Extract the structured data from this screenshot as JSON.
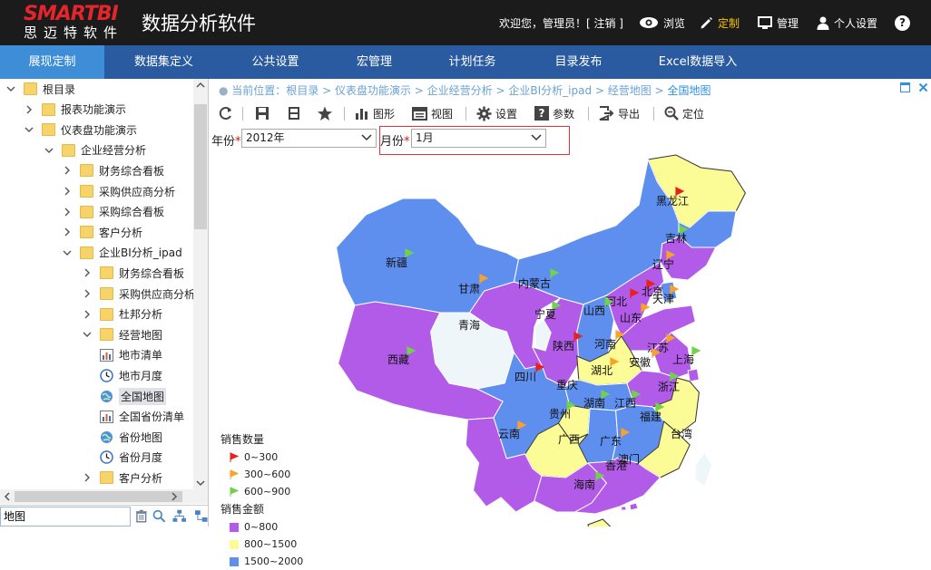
{
  "header": {
    "logo_brand": "SMARTBI",
    "logo_sub": "思迈特软件",
    "app_title": "数据分析软件",
    "welcome": "欢迎您，管理员！[ 注销 ]",
    "actions": [
      {
        "label": "浏览",
        "icon": "eye-icon",
        "color": "#ffffff"
      },
      {
        "label": "定制",
        "icon": "pencil-icon",
        "color": "#f5c400"
      },
      {
        "label": "管理",
        "icon": "monitor-icon",
        "color": "#ffffff"
      },
      {
        "label": "个人设置",
        "icon": "user-icon",
        "color": "#ffffff"
      },
      {
        "label": "?",
        "icon": "help-icon",
        "color": "#ffffff"
      }
    ]
  },
  "nav": {
    "items": [
      "展现定制",
      "数据集定义",
      "公共设置",
      "宏管理",
      "计划任务",
      "目录发布",
      "Excel数据导入"
    ],
    "active": "展现定制"
  },
  "tree": {
    "items": [
      {
        "label": "根目录",
        "type": "folder",
        "expanded": true
      },
      {
        "label": "报表功能演示",
        "type": "folder",
        "expanded": false
      },
      {
        "label": "仪表盘功能演示",
        "type": "folder",
        "expanded": true
      },
      {
        "label": "企业经营分析",
        "type": "folder",
        "expanded": true
      },
      {
        "label": "财务综合看板",
        "type": "folder",
        "expanded": false
      },
      {
        "label": "采购供应商分析",
        "type": "folder",
        "expanded": false
      },
      {
        "label": "采购综合看板",
        "type": "folder",
        "expanded": false
      },
      {
        "label": "客户分析",
        "type": "folder",
        "expanded": false
      },
      {
        "label": "企业BI分析_ipad",
        "type": "folder",
        "expanded": true
      },
      {
        "label": "财务综合看板",
        "type": "folder",
        "expanded": false
      },
      {
        "label": "采购供应商分析",
        "type": "folder",
        "expanded": false
      },
      {
        "label": "杜邦分析",
        "type": "folder",
        "expanded": false
      },
      {
        "label": "经营地图",
        "type": "folder",
        "expanded": true
      },
      {
        "label": "地市清单",
        "type": "report",
        "icon": "table-report-icon"
      },
      {
        "label": "地市月度",
        "type": "report",
        "icon": "clock-report-icon"
      },
      {
        "label": "全国地图",
        "type": "report",
        "icon": "globe-report-icon",
        "selected": true
      },
      {
        "label": "全国省份清单",
        "type": "report",
        "icon": "table-report-icon"
      },
      {
        "label": "省份地图",
        "type": "report",
        "icon": "globe-report-icon"
      },
      {
        "label": "省份月度",
        "type": "report",
        "icon": "clock-report-icon"
      },
      {
        "label": "客户分析",
        "type": "folder",
        "expanded": false
      }
    ],
    "search_value": "地图"
  },
  "breadcrumb": {
    "prefix": "当前位置：",
    "path": "根目录 > 仪表盘功能演示 > 企业经营分析 > 企业BI分析_ipad > 经营地图 > ",
    "current": "全国地图"
  },
  "toolbar": {
    "graph_label": "图形",
    "view_label": "视图",
    "settings_label": "设置",
    "params_label": "参数",
    "export_label": "导出",
    "locate_label": "定位"
  },
  "params": {
    "year_label": "年份",
    "year_value": "2012年",
    "month_label": "月份",
    "month_value": "1月",
    "required_mark": "*"
  },
  "map": {
    "colors": {
      "purple": "#b25be8",
      "yellow": "#fbfc95",
      "blue": "#5e8fee",
      "white": "#eef6fa",
      "red_flag": "#e8211c",
      "orange_flag": "#f7a22a",
      "green_flag": "#6fd24a"
    },
    "provinces": [
      {
        "name": "黑龙江",
        "fill": "yellow",
        "flag": "red"
      },
      {
        "name": "吉林",
        "fill": "blue",
        "flag": "green"
      },
      {
        "name": "辽宁",
        "fill": "purple",
        "flag": "orange"
      },
      {
        "name": "新疆",
        "fill": "blue",
        "flag": "green"
      },
      {
        "name": "内蒙古",
        "fill": "blue",
        "flag": "green"
      },
      {
        "name": "甘肃",
        "fill": "purple",
        "flag": "orange"
      },
      {
        "name": "北京",
        "fill": "purple",
        "flag": "red"
      },
      {
        "name": "天津",
        "fill": "blue",
        "flag": "orange"
      },
      {
        "name": "河北",
        "fill": "purple",
        "flag": "red"
      },
      {
        "name": "山西",
        "fill": "blue",
        "flag": "green"
      },
      {
        "name": "山东",
        "fill": "purple",
        "flag": "orange"
      },
      {
        "name": "宁夏",
        "fill": "white",
        "flag": "green"
      },
      {
        "name": "青海",
        "fill": "white",
        "flag": "none"
      },
      {
        "name": "陕西",
        "fill": "purple",
        "flag": "red"
      },
      {
        "name": "河南",
        "fill": "yellow",
        "flag": "orange"
      },
      {
        "name": "江苏",
        "fill": "purple",
        "flag": "orange"
      },
      {
        "name": "上海",
        "fill": "purple",
        "flag": "green"
      },
      {
        "name": "西藏",
        "fill": "purple",
        "flag": "green"
      },
      {
        "name": "安徽",
        "fill": "purple",
        "flag": "orange"
      },
      {
        "name": "四川",
        "fill": "blue",
        "flag": "red"
      },
      {
        "name": "湖北",
        "fill": "blue",
        "flag": "orange"
      },
      {
        "name": "重庆",
        "fill": "yellow",
        "flag": "none"
      },
      {
        "name": "浙江",
        "fill": "yellow",
        "flag": "green"
      },
      {
        "name": "湖南",
        "fill": "blue",
        "flag": "green"
      },
      {
        "name": "江西",
        "fill": "blue",
        "flag": "green"
      },
      {
        "name": "贵州",
        "fill": "yellow",
        "flag": "green"
      },
      {
        "name": "福建",
        "fill": "yellow",
        "flag": "green"
      },
      {
        "name": "云南",
        "fill": "purple",
        "flag": "orange"
      },
      {
        "name": "广西",
        "fill": "purple",
        "flag": "none"
      },
      {
        "name": "广东",
        "fill": "purple",
        "flag": "orange"
      },
      {
        "name": "台湾",
        "fill": "white",
        "flag": "none"
      },
      {
        "name": "香港",
        "fill": "purple",
        "flag": "none"
      },
      {
        "name": "澳门",
        "fill": "purple",
        "flag": "none"
      },
      {
        "name": "海南",
        "fill": "yellow",
        "flag": "green"
      }
    ]
  },
  "legend": {
    "qty_title": "销售数量",
    "qty_items": [
      {
        "label": "0~300",
        "color": "red_flag"
      },
      {
        "label": "300~600",
        "color": "orange_flag"
      },
      {
        "label": "600~900",
        "color": "green_flag"
      }
    ],
    "amt_title": "销售金额",
    "amt_items": [
      {
        "label": "0~800",
        "color": "purple"
      },
      {
        "label": "800~1500",
        "color": "yellow"
      },
      {
        "label": "1500~2000",
        "color": "blue"
      }
    ]
  }
}
